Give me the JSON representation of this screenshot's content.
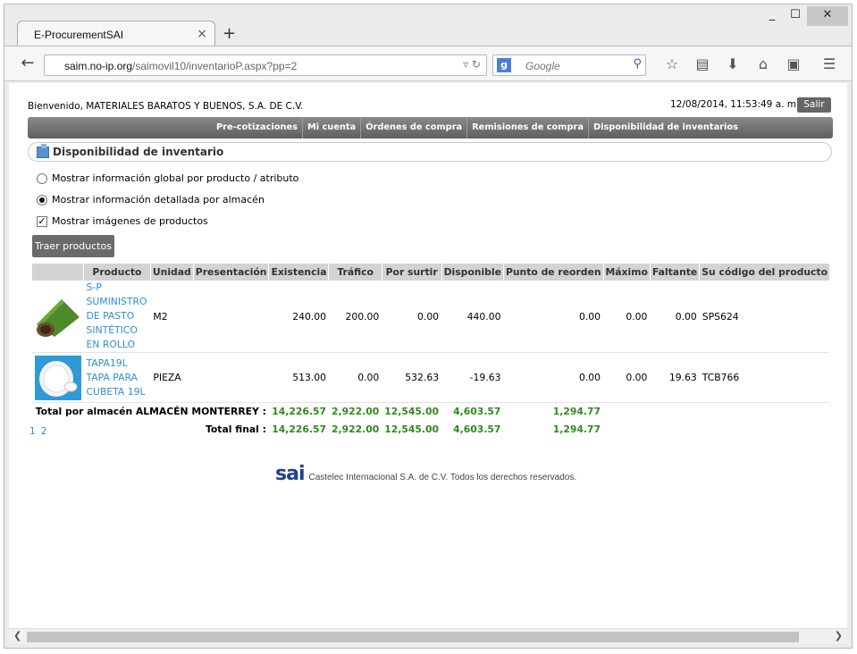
{
  "browser": {
    "tab_title": "E-ProcurementSAI",
    "tab_close": "×",
    "new_tab": "+",
    "url_host": "saim.no-ip.org",
    "url_path": "/saimovil10/inventarioP.aspx?pp=2",
    "url_prefix": "",
    "search_placeholder": "Google",
    "search_engine_icon": "google-icon",
    "min": "_",
    "max": "☐",
    "close": "✕"
  },
  "header": {
    "welcome": "Bienvenido, MATERIALES BARATOS Y BUENOS, S.A. DE C.V.",
    "datetime": "12/08/2014, 11:53:49 a. m.",
    "logout_label": "Salir"
  },
  "menu": {
    "items": [
      "Pre-cotizaciones",
      "Mi cuenta",
      "Órdenes de compra",
      "Remisiones de compra",
      "Disponibilidad de inventarios"
    ]
  },
  "section": {
    "title": "Disponibilidad de inventario"
  },
  "options": {
    "global": "Mostrar información global por producto / atributo",
    "detallada": "Mostrar información detallada por almacén",
    "imagenes": "Mostrar imágenes de productos",
    "selected": "detallada",
    "imagenes_checked": true
  },
  "actions": {
    "traer_label": "Traer productos"
  },
  "table": {
    "headers": [
      "",
      "Producto",
      "Unidad",
      "Presentación",
      "Existencia",
      "Tráfico",
      "Por surtir",
      "Disponible",
      "Punto de reorden",
      "Máximo",
      "Faltante",
      "Su código del producto"
    ],
    "rows": [
      {
        "code": "S-P",
        "name1": "SUMINISTRO DE PASTO",
        "name2": "SINTÉTICO EN ROLLO",
        "unidad": "M2",
        "presentacion": "",
        "existencia": "240.00",
        "trafico": "200.00",
        "por_surtir": "0.00",
        "disponible": "440.00",
        "punto_reorden": "0.00",
        "maximo": "0.00",
        "faltante": "0.00",
        "su_codigo": "SPS624"
      },
      {
        "code": "TAPA19L",
        "name1": "TAPA PARA CUBETA 19L",
        "name2": "",
        "unidad": "PIEZA",
        "presentacion": "",
        "existencia": "513.00",
        "trafico": "0.00",
        "por_surtir": "532.63",
        "disponible": "-19.63",
        "punto_reorden": "0.00",
        "maximo": "0.00",
        "faltante": "19.63",
        "su_codigo": "TCB766"
      }
    ],
    "total_almacen": {
      "label": "Total por almacén ALMACÉN MONTERREY :",
      "existencia": "14,226.57",
      "trafico": "2,922.00",
      "por_surtir": "12,545.00",
      "disponible": "4,603.57",
      "punto_reorden": "1,294.77"
    },
    "total_final": {
      "label": "Total final :",
      "existencia": "14,226.57",
      "trafico": "2,922.00",
      "por_surtir": "12,545.00",
      "disponible": "4,603.57",
      "punto_reorden": "1,294.77"
    }
  },
  "pager": {
    "pages": [
      "1",
      "2"
    ]
  },
  "footer": {
    "logo_text": "sai",
    "copyright": "Castelec Internacional S.A. de C.V. Todos los derechos reservados."
  },
  "colors": {
    "menu_bg": "#6f6f6f",
    "link": "#2f8ed0",
    "total_green": "#2d8a1c",
    "logo_blue": "#1f3f8f"
  }
}
